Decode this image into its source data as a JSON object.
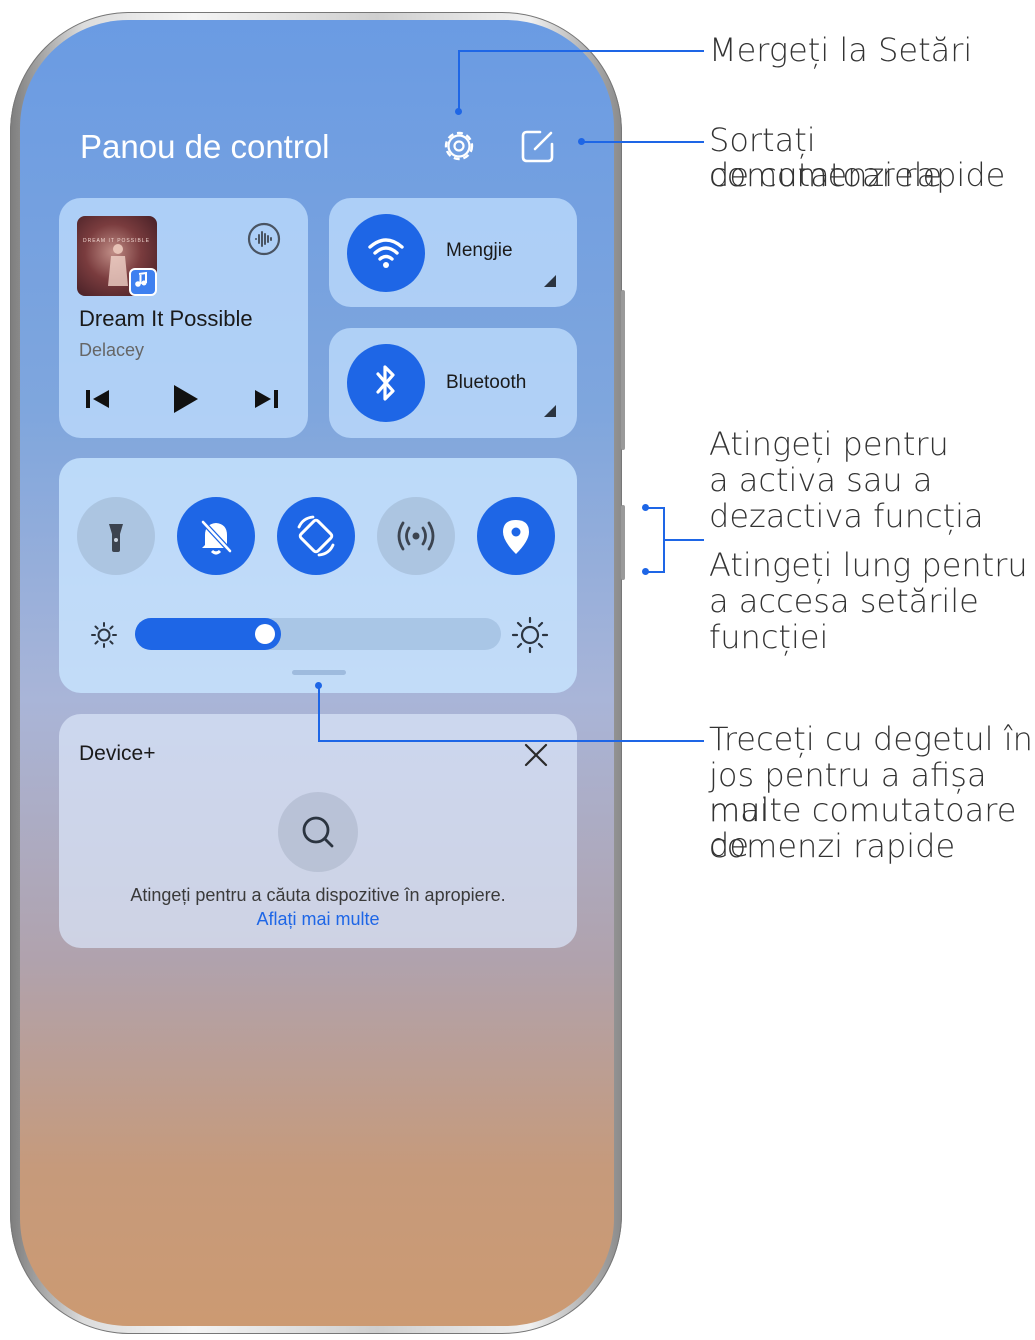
{
  "panel": {
    "title": "Panou de control",
    "settings_icon": "gear-icon",
    "edit_icon": "edit-square-icon"
  },
  "media": {
    "song_title": "Dream It Possible",
    "artist": "Delacey",
    "album_art_text": "DREAM IT POSSIBLE",
    "album_art_icon": "music-app-icon",
    "audio_output_icon": "audio-output-icon",
    "controls": [
      "previous-icon",
      "play-icon",
      "next-icon"
    ]
  },
  "wifi": {
    "label": "Mengjie",
    "icon": "wifi-icon",
    "state": "on"
  },
  "bluetooth": {
    "label": "Bluetooth",
    "icon": "bluetooth-icon",
    "state": "on"
  },
  "toggles": [
    {
      "name": "flashlight",
      "icon": "flashlight-icon",
      "state": "off"
    },
    {
      "name": "silent",
      "icon": "bell-off-icon",
      "state": "on"
    },
    {
      "name": "auto-rotate",
      "icon": "rotate-icon",
      "state": "on"
    },
    {
      "name": "nfc",
      "icon": "wireless-icon",
      "state": "off"
    },
    {
      "name": "location",
      "icon": "location-pin-icon",
      "state": "on"
    }
  ],
  "brightness": {
    "level": 0.4,
    "low_icon": "sun-small-icon",
    "high_icon": "sun-large-icon"
  },
  "device_plus": {
    "title": "Device+",
    "hint": "Atingeți pentru a căuta dispozitive în apropiere.",
    "link": "Aflați mai multe",
    "close_icon": "close-icon",
    "search_icon": "search-icon"
  },
  "callouts": {
    "settings": "Mergeți la Setări",
    "sort_line1": "Sortați comutatoarele",
    "sort_line2": "de comenzi rapide",
    "tap_line1": "Atingeți pentru",
    "tap_line2": "a activa sau a",
    "tap_line3": "dezactiva funcția",
    "long_line1": "Atingeți lung pentru",
    "long_line2": "a accesa setările",
    "long_line3": "funcției",
    "swipe_line1": "Treceți cu degetul în",
    "swipe_line2": "jos pentru a afișa mai",
    "swipe_line3": "multe comutatoare de",
    "swipe_line4": "comenzi rapide"
  },
  "colors": {
    "accent": "#1e66e6",
    "leader": "#1e66e6"
  }
}
